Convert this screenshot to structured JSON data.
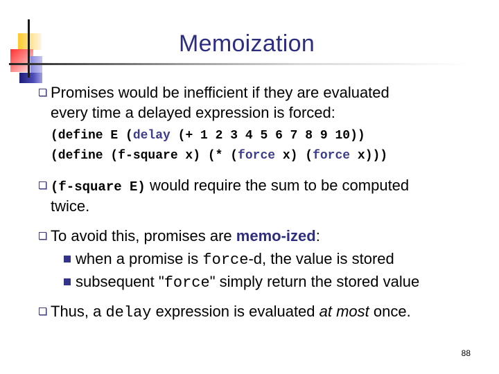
{
  "slide": {
    "title": "Memoization",
    "page_number": "88",
    "accent_color": "#2e2e80",
    "icons": {
      "logo": "colored-squares-crosshair-logo",
      "bullet": "hollow-square-bullet-icon",
      "sub_bullet": "filled-square-bullet-icon"
    }
  },
  "bullets": [
    {
      "line1": "Promises would be inefficient if they are evaluated",
      "line2": "every time a delayed expression is forced:"
    },
    {
      "code_lines": [
        {
          "p1": "(define E (",
          "kw": "delay",
          "p2": " (+ 1 2 3 4 5 6 7 8 9 10))"
        },
        {
          "p1": "(define (f-square x) (* (",
          "kw1": "force",
          "p2": " x) (",
          "kw2": "force",
          "p3": " x)))"
        }
      ]
    },
    {
      "code": "(f-square E)",
      "line1_rest": " would require the sum to be computed",
      "line2": "twice."
    },
    {
      "pre": "To avoid this, promises are ",
      "accent": "memo-ized",
      "post": ":",
      "sub_bullets": [
        {
          "pre": "when a promise is ",
          "code": "force",
          "post": "-d, the value is stored"
        },
        {
          "pre": "subsequent \"",
          "code": "force",
          "post": "\" simply return the stored value"
        }
      ]
    },
    {
      "pre": "Thus, a ",
      "code": "delay",
      "mid": " expression is evaluated ",
      "italic": "at most",
      "post": " once."
    }
  ]
}
